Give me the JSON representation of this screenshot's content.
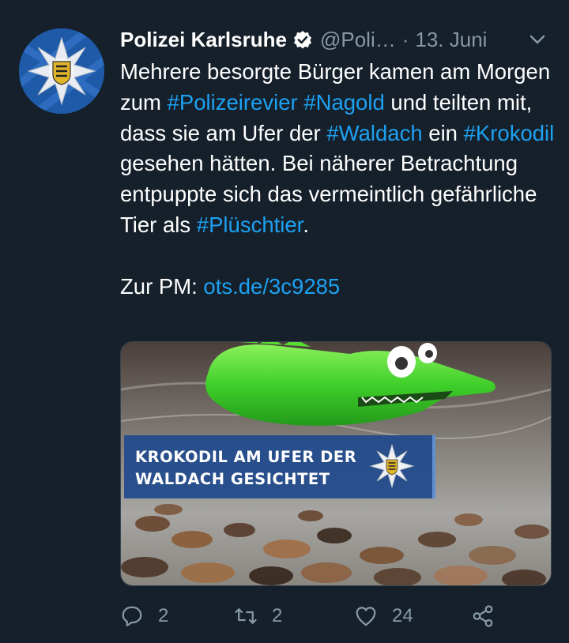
{
  "author": {
    "name": "Polizei Karlsruhe",
    "handle": "@Poli…",
    "separator": "·",
    "date": "13. Juni"
  },
  "tweet": {
    "segments": [
      {
        "text": "Mehrere besorgte Bürger kamen am Morgen zum ",
        "type": "text"
      },
      {
        "text": "#Polizeirevier",
        "type": "tag"
      },
      {
        "text": " ",
        "type": "text"
      },
      {
        "text": "#Nagold",
        "type": "tag"
      },
      {
        "text": " und teilten mit, dass sie am Ufer der ",
        "type": "text"
      },
      {
        "text": "#Waldach",
        "type": "tag"
      },
      {
        "text": " ein ",
        "type": "text"
      },
      {
        "text": "#Krokodil",
        "type": "tag"
      },
      {
        "text": " gesehen hätten. Bei näherer Betrachtung entpuppte sich das vermeintlich gefährliche Tier als ",
        "type": "text"
      },
      {
        "text": "#Plüschtier",
        "type": "tag"
      },
      {
        "text": ".",
        "type": "text"
      }
    ],
    "pm_label": "Zur PM: ",
    "pm_link": "ots.de/3c9285"
  },
  "media": {
    "banner_line1": "KROKODIL AM UFER DER",
    "banner_line2": "WALDACH GESICHTET"
  },
  "actions": {
    "replies": "2",
    "retweets": "2",
    "likes": "24"
  },
  "colors": {
    "background": "#15202b",
    "accent": "#1da1f2",
    "muted": "#8899a6",
    "banner": "#1f4a8c"
  },
  "icons": [
    "police-star-icon",
    "verified-badge-icon",
    "chevron-down-icon",
    "reply-icon",
    "retweet-icon",
    "like-icon",
    "share-icon"
  ]
}
